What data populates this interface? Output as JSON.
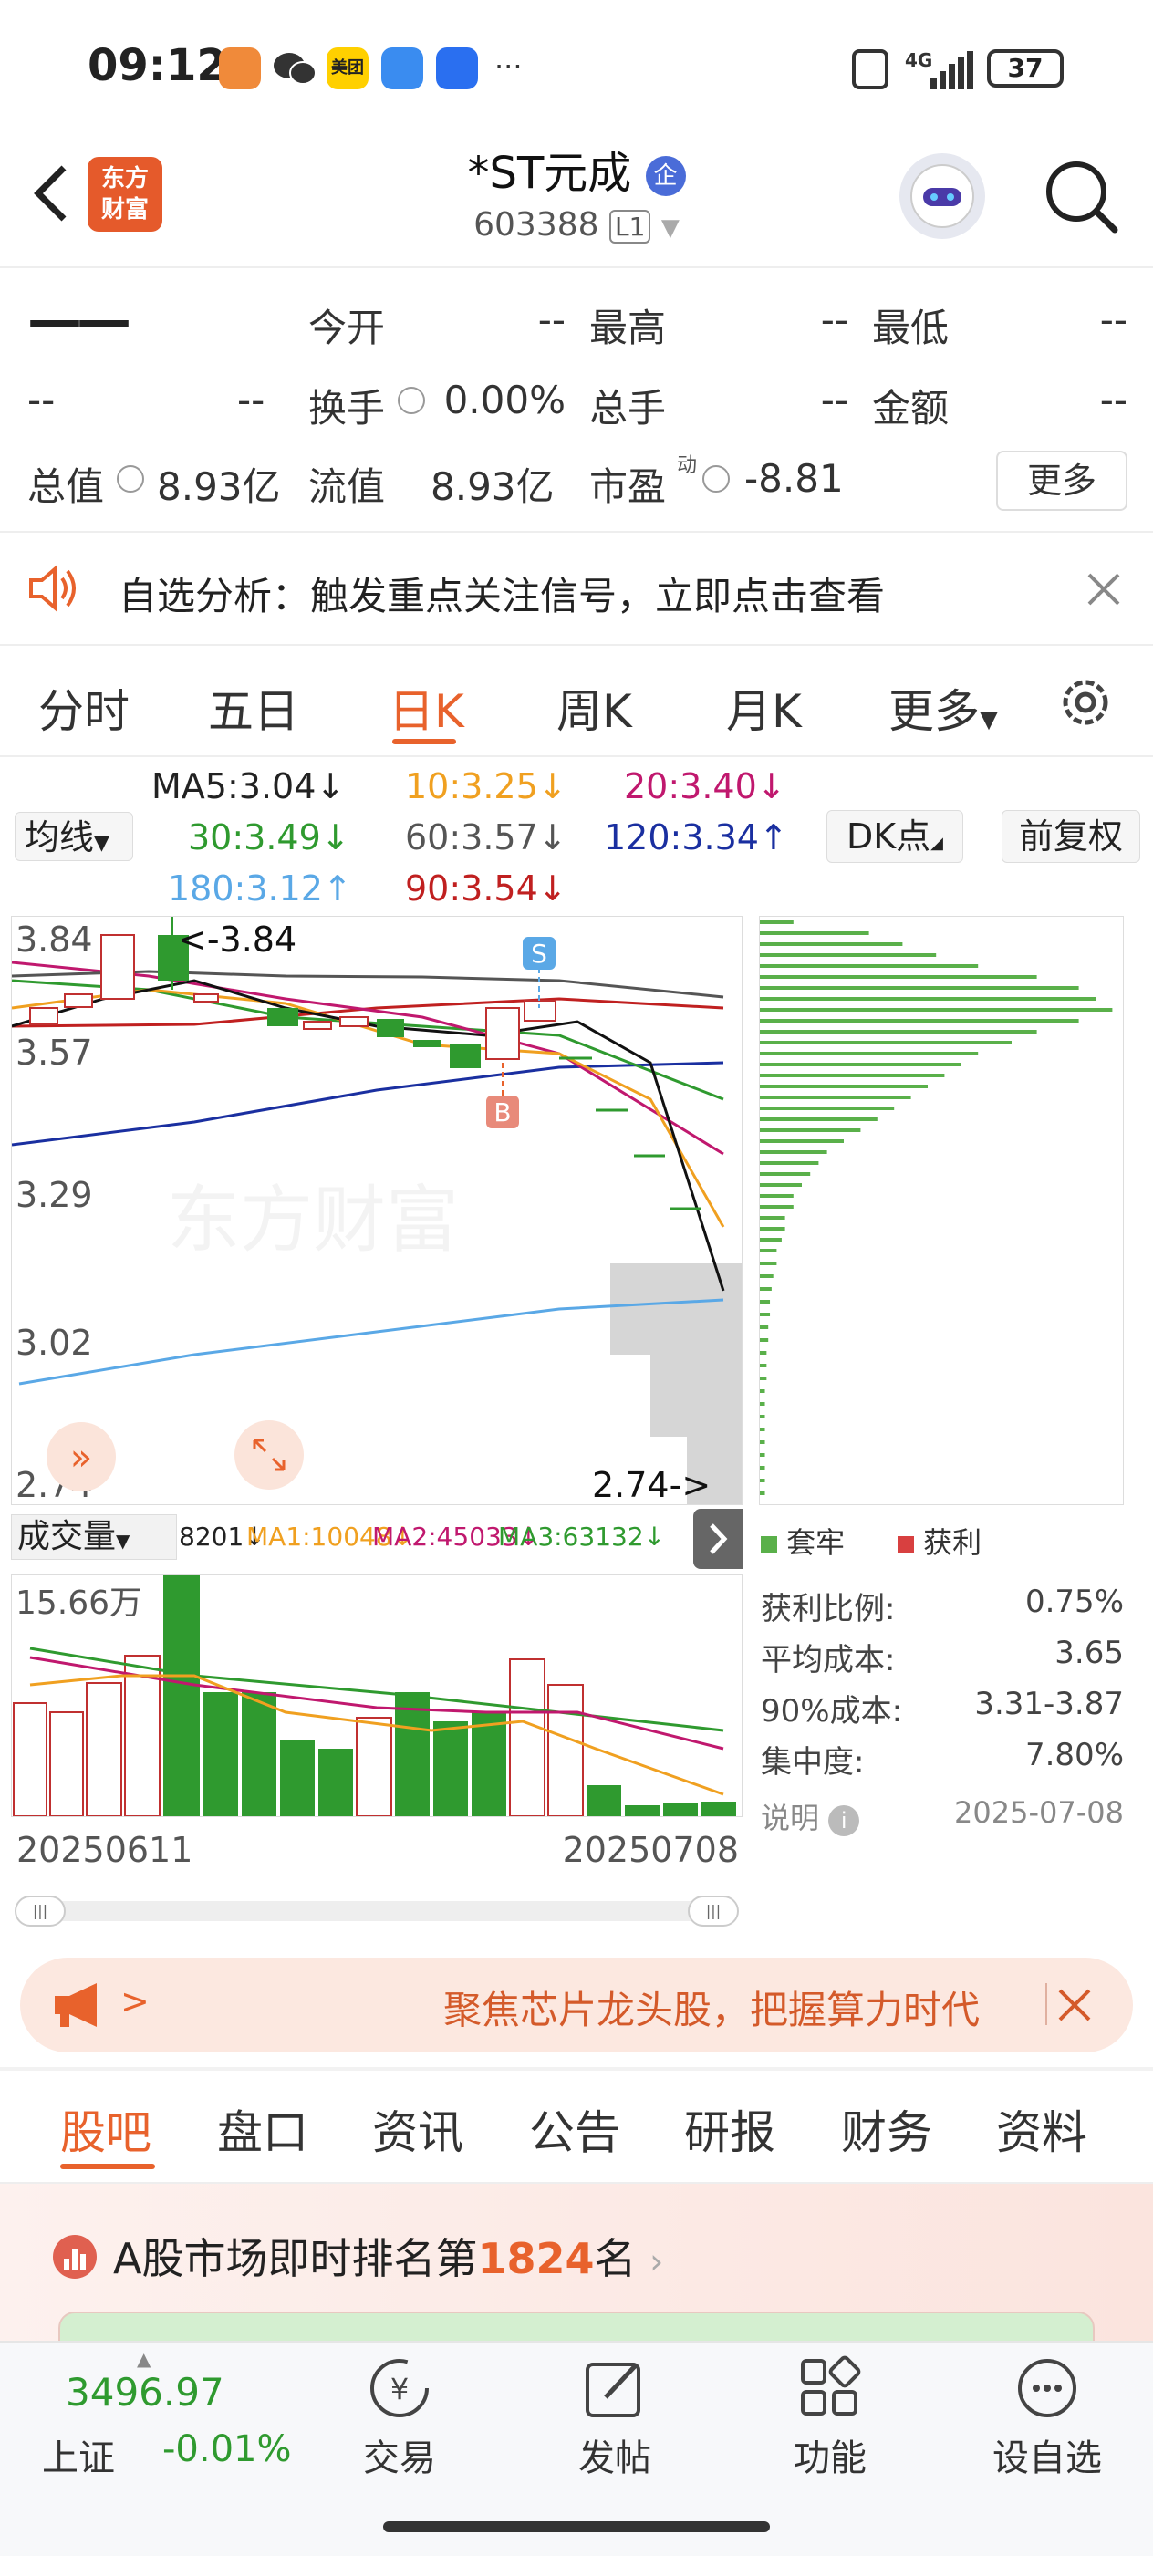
{
  "status": {
    "time": "09:12",
    "battery": "37",
    "network": "4G",
    "dots": "···",
    "meituan_label": "美团"
  },
  "header": {
    "logo_text_1": "东方",
    "logo_text_2": "财富",
    "title": "*ST元成",
    "badge": "企",
    "code": "603388",
    "level": "L1"
  },
  "quote": {
    "price": "——",
    "change_a": "--",
    "change_b": "--",
    "open_label": "今开",
    "open_value": "--",
    "high_label": "最高",
    "high_value": "--",
    "low_label": "最低",
    "low_value": "--",
    "turnover_label": "换手",
    "turnover_value": "0.00%",
    "volume_label": "总手",
    "volume_value": "--",
    "amount_label": "金额",
    "amount_value": "--",
    "mcap_label": "总值",
    "mcap_value": "8.93亿",
    "float_label": "流值",
    "float_value": "8.93亿",
    "pe_label": "市盈",
    "pe_sup": "动",
    "pe_value": "-8.81",
    "more_button": "更多"
  },
  "notice": {
    "text": "自选分析：触发重点关注信号，立即点击查看"
  },
  "period_tabs": [
    "分时",
    "五日",
    "日K",
    "周K",
    "月K",
    "更多"
  ],
  "active_period": "日K",
  "ma_bar": {
    "avg_label": "均线",
    "ma5": "MA5:3.04↓",
    "ma10": "10:3.25↓",
    "ma20": "20:3.40↓",
    "ma30": "30:3.49↓",
    "ma60": "60:3.57↓",
    "ma120": "120:3.34↑",
    "ma180": "180:3.12↑",
    "ma90": "90:3.54↓",
    "dk_button": "DK点",
    "adjust_button": "前复权",
    "colors": {
      "ma5": "#222222",
      "ma10": "#f0a020",
      "ma20": "#c0186e",
      "ma30": "#2f9a2f",
      "ma60": "#555555",
      "ma120": "#1a2fa0",
      "ma180": "#5aa8e6",
      "ma90": "#c02020"
    }
  },
  "kline": {
    "y_ticks": [
      "3.84",
      "3.57",
      "3.29",
      "3.02",
      "2.74"
    ],
    "high_marker": "<-3.84",
    "low_marker": "2.74->",
    "sell_marker": "S",
    "buy_marker": "B",
    "watermark": "东方财富"
  },
  "volume": {
    "selector": "成交量",
    "vol_value": "8201↓",
    "ma1": "MA1:10048↓",
    "ma2": "MA2:45033↓",
    "ma3": "MA3:63132↓",
    "max_label": "15.66万",
    "start_date": "20250611",
    "end_date": "20250708"
  },
  "distribution": {
    "legend_trapped": "套牢",
    "legend_profit": "获利",
    "rows": [
      {
        "label": "获利比例:",
        "value": "0.75%"
      },
      {
        "label": "平均成本:",
        "value": "3.65"
      },
      {
        "label": "90%成本:",
        "value": "3.31-3.87"
      },
      {
        "label": "集中度:",
        "value": "7.80%"
      }
    ],
    "note_label": "说明",
    "date": "2025-07-08"
  },
  "ad_banner": {
    "arrow": ">",
    "text": "聚焦芯片龙头股，把握算力时代"
  },
  "sub_tabs": [
    "股吧",
    "盘口",
    "资讯",
    "公告",
    "研报",
    "财务",
    "资料"
  ],
  "active_sub_tab": "股吧",
  "rank": {
    "prefix": "A股市场即时排名第",
    "rank": "1824",
    "suffix": "名"
  },
  "bottom_nav": {
    "index_value": "3496.97",
    "index_name": "上证",
    "index_change": "-0.01%",
    "items": [
      "交易",
      "发帖",
      "功能",
      "设自选"
    ]
  }
}
